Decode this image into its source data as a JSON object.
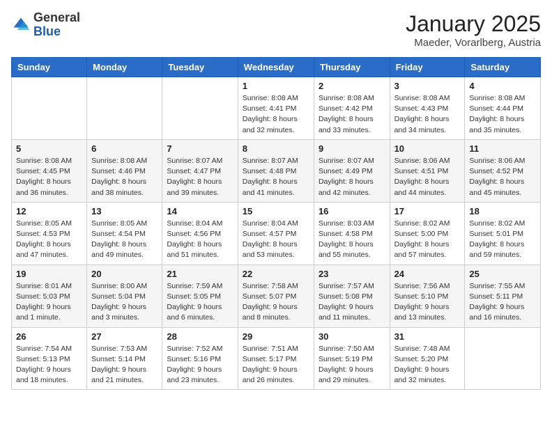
{
  "header": {
    "logo_general": "General",
    "logo_blue": "Blue",
    "month_title": "January 2025",
    "location": "Maeder, Vorarlberg, Austria"
  },
  "days_of_week": [
    "Sunday",
    "Monday",
    "Tuesday",
    "Wednesday",
    "Thursday",
    "Friday",
    "Saturday"
  ],
  "weeks": [
    [
      {
        "day": "",
        "info": ""
      },
      {
        "day": "",
        "info": ""
      },
      {
        "day": "",
        "info": ""
      },
      {
        "day": "1",
        "info": "Sunrise: 8:08 AM\nSunset: 4:41 PM\nDaylight: 8 hours and 32 minutes."
      },
      {
        "day": "2",
        "info": "Sunrise: 8:08 AM\nSunset: 4:42 PM\nDaylight: 8 hours and 33 minutes."
      },
      {
        "day": "3",
        "info": "Sunrise: 8:08 AM\nSunset: 4:43 PM\nDaylight: 8 hours and 34 minutes."
      },
      {
        "day": "4",
        "info": "Sunrise: 8:08 AM\nSunset: 4:44 PM\nDaylight: 8 hours and 35 minutes."
      }
    ],
    [
      {
        "day": "5",
        "info": "Sunrise: 8:08 AM\nSunset: 4:45 PM\nDaylight: 8 hours and 36 minutes."
      },
      {
        "day": "6",
        "info": "Sunrise: 8:08 AM\nSunset: 4:46 PM\nDaylight: 8 hours and 38 minutes."
      },
      {
        "day": "7",
        "info": "Sunrise: 8:07 AM\nSunset: 4:47 PM\nDaylight: 8 hours and 39 minutes."
      },
      {
        "day": "8",
        "info": "Sunrise: 8:07 AM\nSunset: 4:48 PM\nDaylight: 8 hours and 41 minutes."
      },
      {
        "day": "9",
        "info": "Sunrise: 8:07 AM\nSunset: 4:49 PM\nDaylight: 8 hours and 42 minutes."
      },
      {
        "day": "10",
        "info": "Sunrise: 8:06 AM\nSunset: 4:51 PM\nDaylight: 8 hours and 44 minutes."
      },
      {
        "day": "11",
        "info": "Sunrise: 8:06 AM\nSunset: 4:52 PM\nDaylight: 8 hours and 45 minutes."
      }
    ],
    [
      {
        "day": "12",
        "info": "Sunrise: 8:05 AM\nSunset: 4:53 PM\nDaylight: 8 hours and 47 minutes."
      },
      {
        "day": "13",
        "info": "Sunrise: 8:05 AM\nSunset: 4:54 PM\nDaylight: 8 hours and 49 minutes."
      },
      {
        "day": "14",
        "info": "Sunrise: 8:04 AM\nSunset: 4:56 PM\nDaylight: 8 hours and 51 minutes."
      },
      {
        "day": "15",
        "info": "Sunrise: 8:04 AM\nSunset: 4:57 PM\nDaylight: 8 hours and 53 minutes."
      },
      {
        "day": "16",
        "info": "Sunrise: 8:03 AM\nSunset: 4:58 PM\nDaylight: 8 hours and 55 minutes."
      },
      {
        "day": "17",
        "info": "Sunrise: 8:02 AM\nSunset: 5:00 PM\nDaylight: 8 hours and 57 minutes."
      },
      {
        "day": "18",
        "info": "Sunrise: 8:02 AM\nSunset: 5:01 PM\nDaylight: 8 hours and 59 minutes."
      }
    ],
    [
      {
        "day": "19",
        "info": "Sunrise: 8:01 AM\nSunset: 5:03 PM\nDaylight: 9 hours and 1 minute."
      },
      {
        "day": "20",
        "info": "Sunrise: 8:00 AM\nSunset: 5:04 PM\nDaylight: 9 hours and 3 minutes."
      },
      {
        "day": "21",
        "info": "Sunrise: 7:59 AM\nSunset: 5:05 PM\nDaylight: 9 hours and 6 minutes."
      },
      {
        "day": "22",
        "info": "Sunrise: 7:58 AM\nSunset: 5:07 PM\nDaylight: 9 hours and 8 minutes."
      },
      {
        "day": "23",
        "info": "Sunrise: 7:57 AM\nSunset: 5:08 PM\nDaylight: 9 hours and 11 minutes."
      },
      {
        "day": "24",
        "info": "Sunrise: 7:56 AM\nSunset: 5:10 PM\nDaylight: 9 hours and 13 minutes."
      },
      {
        "day": "25",
        "info": "Sunrise: 7:55 AM\nSunset: 5:11 PM\nDaylight: 9 hours and 16 minutes."
      }
    ],
    [
      {
        "day": "26",
        "info": "Sunrise: 7:54 AM\nSunset: 5:13 PM\nDaylight: 9 hours and 18 minutes."
      },
      {
        "day": "27",
        "info": "Sunrise: 7:53 AM\nSunset: 5:14 PM\nDaylight: 9 hours and 21 minutes."
      },
      {
        "day": "28",
        "info": "Sunrise: 7:52 AM\nSunset: 5:16 PM\nDaylight: 9 hours and 23 minutes."
      },
      {
        "day": "29",
        "info": "Sunrise: 7:51 AM\nSunset: 5:17 PM\nDaylight: 9 hours and 26 minutes."
      },
      {
        "day": "30",
        "info": "Sunrise: 7:50 AM\nSunset: 5:19 PM\nDaylight: 9 hours and 29 minutes."
      },
      {
        "day": "31",
        "info": "Sunrise: 7:48 AM\nSunset: 5:20 PM\nDaylight: 9 hours and 32 minutes."
      },
      {
        "day": "",
        "info": ""
      }
    ]
  ]
}
